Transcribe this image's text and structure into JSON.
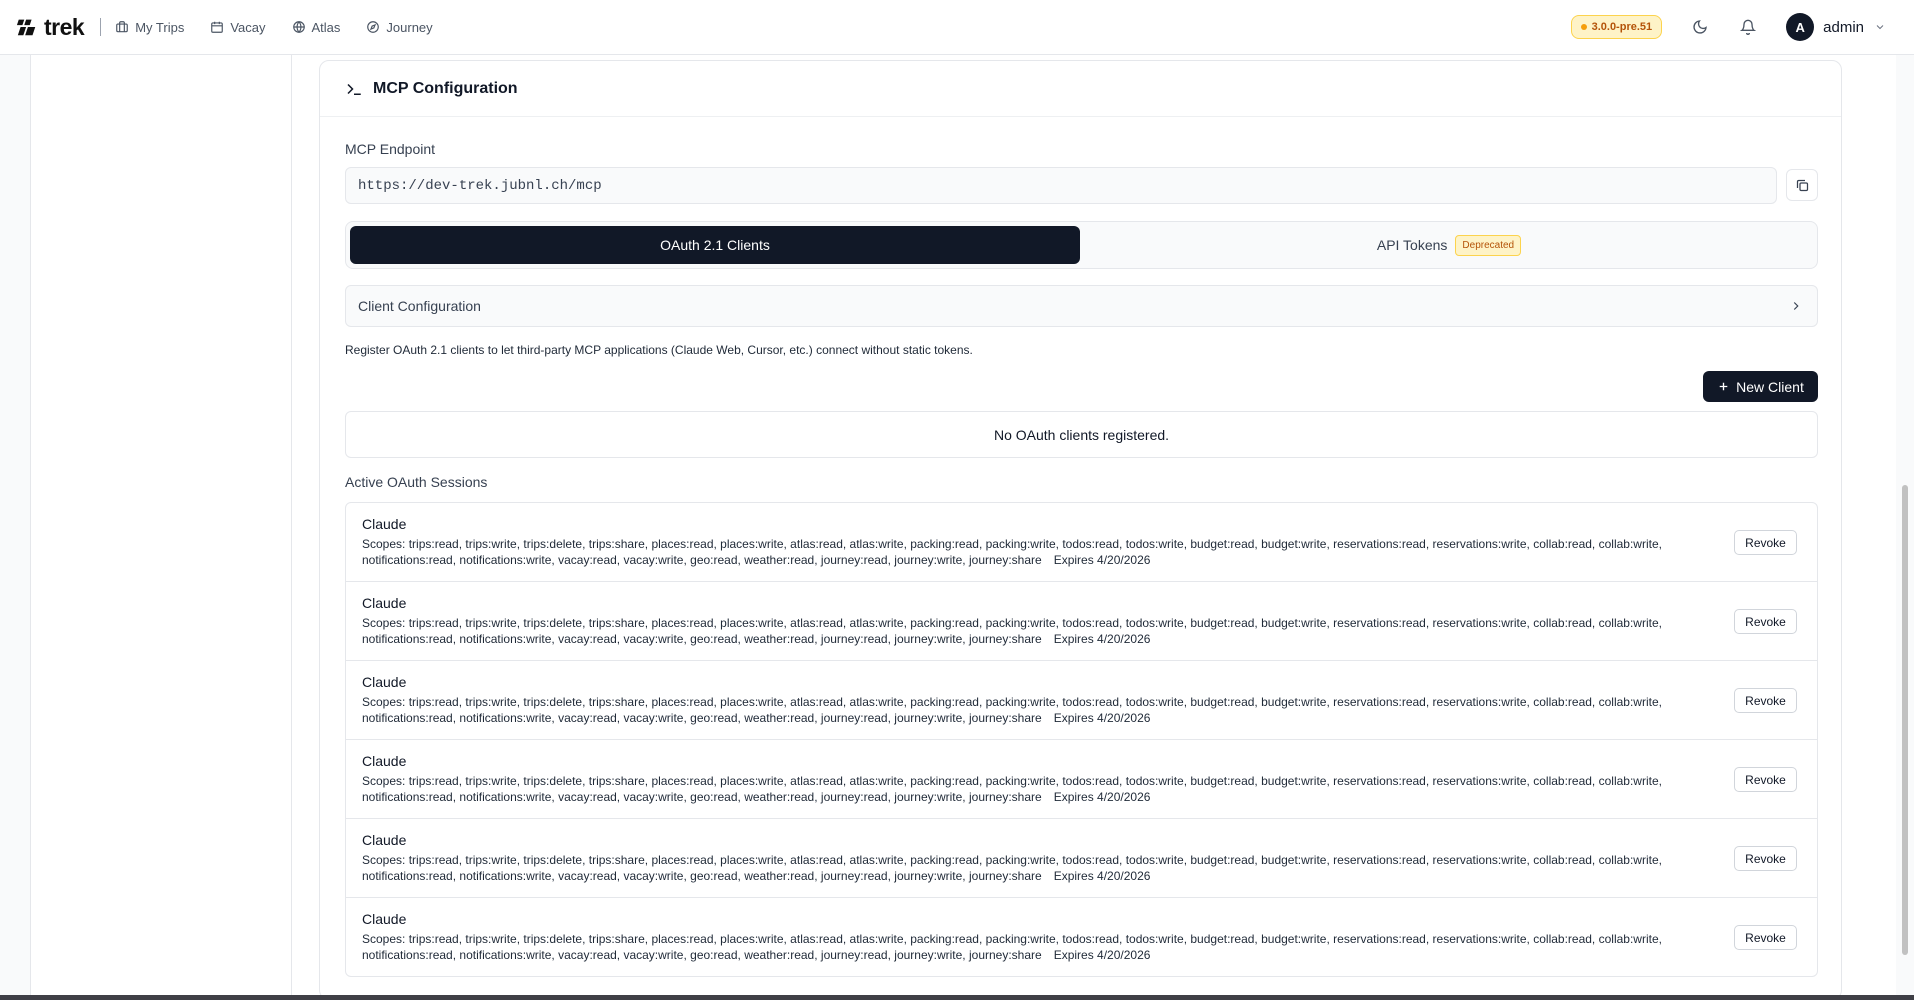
{
  "nav": {
    "brand": "trek",
    "items": [
      {
        "label": "My Trips",
        "icon": "briefcase-icon"
      },
      {
        "label": "Vacay",
        "icon": "calendar-icon"
      },
      {
        "label": "Atlas",
        "icon": "globe-icon"
      },
      {
        "label": "Journey",
        "icon": "compass-icon"
      }
    ],
    "version": "3.0.0-pre.51",
    "user": {
      "initial": "A",
      "name": "admin"
    }
  },
  "mcp": {
    "title": "MCP Configuration",
    "endpoint_label": "MCP Endpoint",
    "endpoint_value": "https://dev-trek.jubnl.ch/mcp",
    "tabs": {
      "oauth": "OAuth 2.1 Clients",
      "api_tokens": "API Tokens",
      "deprecated_badge": "Deprecated"
    },
    "client_config_label": "Client Configuration",
    "description": "Register OAuth 2.1 clients to let third-party MCP applications (Claude Web, Cursor, etc.) connect without static tokens.",
    "new_client_label": "New Client",
    "empty_state": "No OAuth clients registered.",
    "sessions_label": "Active OAuth Sessions",
    "sessions": [
      {
        "name": "Claude",
        "scopes": "Scopes: trips:read, trips:write, trips:delete, trips:share, places:read, places:write, atlas:read, atlas:write, packing:read, packing:write, todos:read, todos:write, budget:read, budget:write, reservations:read, reservations:write, collab:read, collab:write, notifications:read, notifications:write, vacay:read, vacay:write, geo:read, weather:read, journey:read, journey:write, journey:share",
        "expires": "Expires 4/20/2026",
        "revoke": "Revoke"
      },
      {
        "name": "Claude",
        "scopes": "Scopes: trips:read, trips:write, trips:delete, trips:share, places:read, places:write, atlas:read, atlas:write, packing:read, packing:write, todos:read, todos:write, budget:read, budget:write, reservations:read, reservations:write, collab:read, collab:write, notifications:read, notifications:write, vacay:read, vacay:write, geo:read, weather:read, journey:read, journey:write, journey:share",
        "expires": "Expires 4/20/2026",
        "revoke": "Revoke"
      },
      {
        "name": "Claude",
        "scopes": "Scopes: trips:read, trips:write, trips:delete, trips:share, places:read, places:write, atlas:read, atlas:write, packing:read, packing:write, todos:read, todos:write, budget:read, budget:write, reservations:read, reservations:write, collab:read, collab:write, notifications:read, notifications:write, vacay:read, vacay:write, geo:read, weather:read, journey:read, journey:write, journey:share",
        "expires": "Expires 4/20/2026",
        "revoke": "Revoke"
      },
      {
        "name": "Claude",
        "scopes": "Scopes: trips:read, trips:write, trips:delete, trips:share, places:read, places:write, atlas:read, atlas:write, packing:read, packing:write, todos:read, todos:write, budget:read, budget:write, reservations:read, reservations:write, collab:read, collab:write, notifications:read, notifications:write, vacay:read, vacay:write, geo:read, weather:read, journey:read, journey:write, journey:share",
        "expires": "Expires 4/20/2026",
        "revoke": "Revoke"
      },
      {
        "name": "Claude",
        "scopes": "Scopes: trips:read, trips:write, trips:delete, trips:share, places:read, places:write, atlas:read, atlas:write, packing:read, packing:write, todos:read, todos:write, budget:read, budget:write, reservations:read, reservations:write, collab:read, collab:write, notifications:read, notifications:write, vacay:read, vacay:write, geo:read, weather:read, journey:read, journey:write, journey:share",
        "expires": "Expires 4/20/2026",
        "revoke": "Revoke"
      },
      {
        "name": "Claude",
        "scopes": "Scopes: trips:read, trips:write, trips:delete, trips:share, places:read, places:write, atlas:read, atlas:write, packing:read, packing:write, todos:read, todos:write, budget:read, budget:write, reservations:read, reservations:write, collab:read, collab:write, notifications:read, notifications:write, vacay:read, vacay:write, geo:read, weather:read, journey:read, journey:write, journey:share",
        "expires": "Expires 4/20/2026",
        "revoke": "Revoke"
      }
    ]
  },
  "colors": {
    "primary_dark": "#111827",
    "badge_bg": "#fef3c7",
    "badge_text": "#b45309",
    "border": "#e5e7eb"
  }
}
